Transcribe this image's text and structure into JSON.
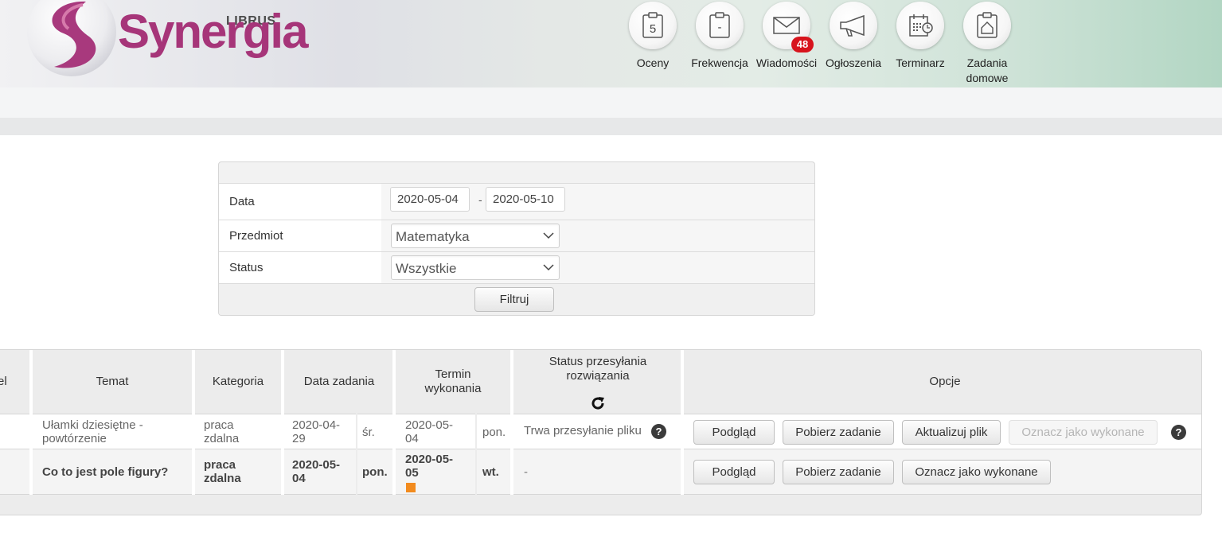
{
  "header": {
    "logo_top": "LIBRUS",
    "logo_main": "Synergia",
    "nav": [
      {
        "label": "Oceny",
        "icon": "grades-icon",
        "glyph": "5"
      },
      {
        "label": "Frekwencja",
        "icon": "attendance-icon",
        "glyph": "-"
      },
      {
        "label": "Wiadomości",
        "icon": "envelope-icon",
        "badge": "48"
      },
      {
        "label": "Ogłoszenia",
        "icon": "megaphone-icon"
      },
      {
        "label": "Terminarz",
        "icon": "calendar-icon"
      },
      {
        "label": "Zadania domowe",
        "icon": "homework-icon"
      }
    ]
  },
  "filter": {
    "date_label": "Data",
    "date_from": "2020-05-04",
    "date_sep": "-",
    "date_to": "2020-05-10",
    "subject_label": "Przedmiot",
    "subject_value": "Matematyka",
    "status_label": "Status",
    "status_value": "Wszystkie",
    "filter_button": "Filtruj"
  },
  "table": {
    "headers": {
      "first_partial": "el",
      "topic": "Temat",
      "category": "Kategoria",
      "date_assigned": "Data zadania",
      "deadline": "Termin wykonania",
      "upload_status": "Status przesyłania rozwiązania",
      "options": "Opcje"
    },
    "rows": [
      {
        "topic": "Ułamki dziesiętne - powtórzenie",
        "category": "praca zdalna",
        "date_assigned": "2020-04-29",
        "date_assigned_day": "śr.",
        "deadline": "2020-05-04",
        "deadline_day": "pon.",
        "upload_status": "Trwa przesyłanie pliku",
        "buttons": [
          "Podgląd",
          "Pobierz zadanie",
          "Aktualizuj plik",
          "Oznacz jako wykonane"
        ]
      },
      {
        "topic": "Co to jest pole figury?",
        "category": "praca zdalna",
        "date_assigned": "2020-05-04",
        "date_assigned_day": "pon.",
        "deadline": "2020-05-05",
        "deadline_day": "wt.",
        "upload_status": "-",
        "buttons": [
          "Podgląd",
          "Pobierz zadanie",
          "Oznacz jako wykonane"
        ]
      }
    ],
    "help_glyph": "?"
  },
  "colors": {
    "brand": "#a63579",
    "badge": "#d7141d",
    "orange_marker": "#f28b1e"
  }
}
